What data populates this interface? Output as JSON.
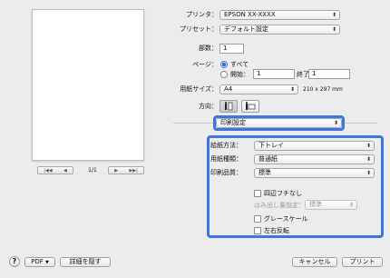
{
  "preview": {
    "page_indicator": "1/1"
  },
  "printer": {
    "label": "プリンタ：",
    "value": "EPSON XX-XXXX"
  },
  "preset": {
    "label": "プリセット：",
    "value": "デフォルト設定"
  },
  "copies": {
    "label": "部数：",
    "value": "1"
  },
  "pages": {
    "label": "ページ：",
    "all_label": "すべて",
    "from_label": "開始：",
    "from_value": "1",
    "to_label": "終了：",
    "to_value": "1"
  },
  "paper_size": {
    "label": "用紙サイズ：",
    "value": "A4",
    "dimensions": "210 x 297 mm"
  },
  "orientation": {
    "label": "方向："
  },
  "section_popup": {
    "value": "印刷設定"
  },
  "print_settings": {
    "paper_source": {
      "label": "給紙方法：",
      "value": "下トレイ"
    },
    "media_type": {
      "label": "用紙種類：",
      "value": "普通紙"
    },
    "print_quality": {
      "label": "印刷品質：",
      "value": "標準"
    },
    "borderless": {
      "label": "四辺フチなし"
    },
    "expansion": {
      "label": "はみ出し量設定：",
      "value": "標準"
    },
    "grayscale": {
      "label": "グレースケール"
    },
    "mirror": {
      "label": "左右反転"
    }
  },
  "footer": {
    "help": "?",
    "pdf": "PDF",
    "hide_details": "詳細を隠す",
    "cancel": "キャンセル",
    "print": "プリント"
  },
  "colors": {
    "accent": "#3d76e0"
  }
}
